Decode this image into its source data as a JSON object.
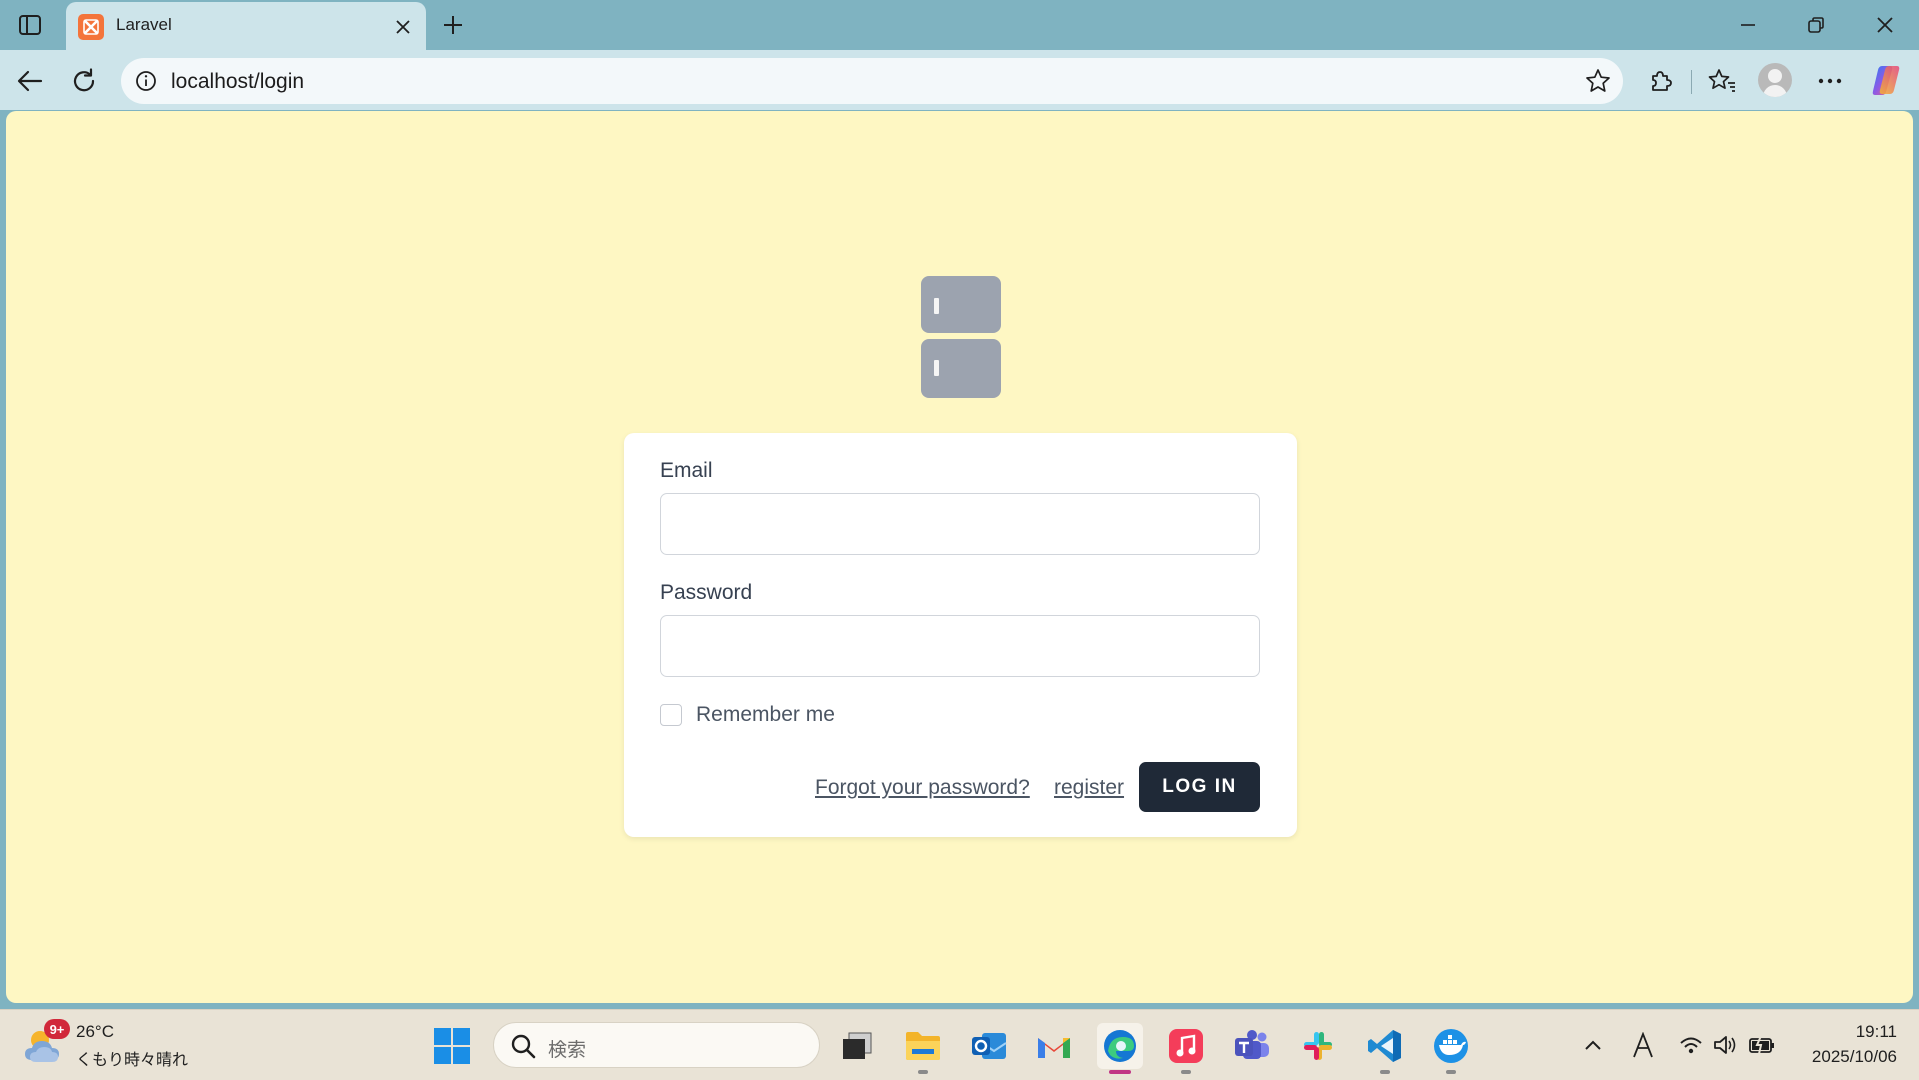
{
  "browser": {
    "tab": {
      "title": "Laravel"
    },
    "address": {
      "url": "localhost/login"
    }
  },
  "login_form": {
    "email_label": "Email",
    "email_value": "",
    "password_label": "Password",
    "password_value": "",
    "remember_label": "Remember me",
    "remember_checked": false,
    "forgot_link": "Forgot your password?",
    "register_link": "register",
    "login_button": "LOG IN"
  },
  "taskbar": {
    "weather": {
      "badge": "9+",
      "temperature": "26°C",
      "condition": "くもり時々晴れ"
    },
    "search_placeholder": "検索",
    "clock": {
      "time": "19:11",
      "date": "2025/10/06"
    }
  },
  "colors": {
    "page_background": "#fef7c3",
    "button_dark": "#1f2937",
    "tab_strip": "#7fb3c1"
  }
}
